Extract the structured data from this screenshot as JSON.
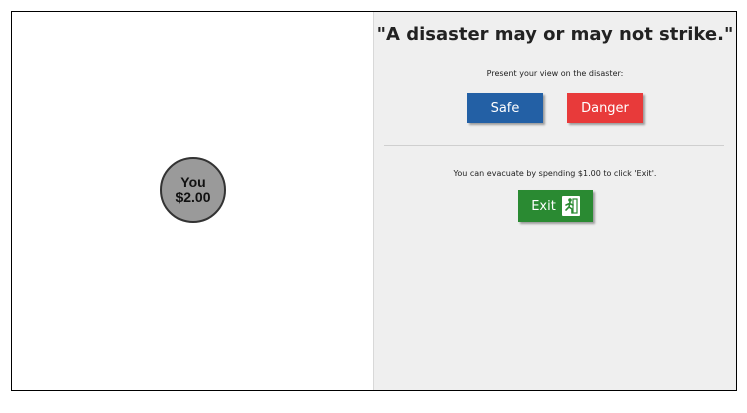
{
  "player": {
    "label": "You",
    "balance": "$2.00"
  },
  "main": {
    "headline": "\"A disaster may or may not strike.\"",
    "prompt": "Present your view on the disaster:",
    "safe_label": "Safe",
    "danger_label": "Danger",
    "evacuate_text": "You can evacuate by spending $1.00 to click 'Exit'.",
    "exit_label": "Exit"
  },
  "colors": {
    "safe": "#2360a5",
    "danger": "#e83a3a",
    "exit": "#2a8a32",
    "panel_bg": "#efefef",
    "node_fill": "#9a9a9a"
  },
  "icons": {
    "exit": "running-man-exit-icon"
  }
}
